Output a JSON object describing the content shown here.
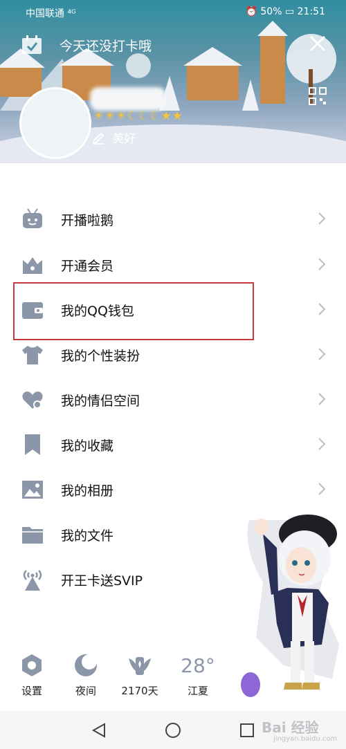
{
  "status_bar": {
    "carrier": "中国联通 ⁴ᴳ",
    "battery": "50%",
    "time": "21:51"
  },
  "header": {
    "checkin_text": "今天还没打卡哦",
    "level_icons": "☀☀☀☾☾☾★★",
    "signature": "美好"
  },
  "menu": {
    "items": [
      {
        "label": "开播啦鹅",
        "icon": "tv-icon"
      },
      {
        "label": "开通会员",
        "icon": "crown-icon"
      },
      {
        "label": "我的QQ钱包",
        "icon": "wallet-icon"
      },
      {
        "label": "我的个性装扮",
        "icon": "shirt-icon"
      },
      {
        "label": "我的情侣空间",
        "icon": "heart-icon"
      },
      {
        "label": "我的收藏",
        "icon": "bookmark-icon"
      },
      {
        "label": "我的相册",
        "icon": "photo-icon"
      },
      {
        "label": "我的文件",
        "icon": "folder-icon"
      },
      {
        "label": "开王卡送SVIP",
        "icon": "antenna-icon"
      }
    ]
  },
  "bottom": {
    "settings_label": "设置",
    "night_label": "夜间",
    "days_label": "2170天",
    "temperature": "28°",
    "city": "江夏"
  },
  "watermark": {
    "main": "Bai 经验",
    "sub": "jingyan.baidu.com"
  },
  "colors": {
    "icon_color": "#8b96a8",
    "highlight_border": "#c8383c",
    "header_gradient_top": "#2f8ea0"
  }
}
